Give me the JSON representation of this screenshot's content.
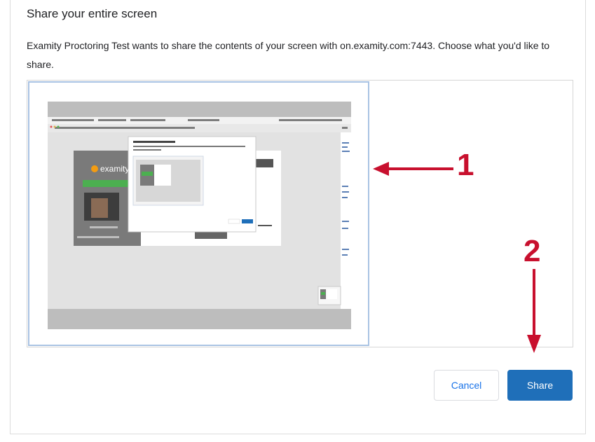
{
  "dialog": {
    "title": "Share your entire screen",
    "description": "Examity Proctoring Test wants to share the contents of your screen with on.examity.com:7443. Choose what you'd like to share."
  },
  "screen_tile": {
    "thumbnail": "screen-preview",
    "thumbnail_brand": "examity"
  },
  "buttons": {
    "cancel_label": "Cancel",
    "share_label": "Share"
  },
  "annotations": {
    "marker_1": "1",
    "marker_2": "2",
    "color": "#c8102e"
  },
  "colors": {
    "accent": "#1f6fb9",
    "selection_border": "#a9c3e3"
  }
}
